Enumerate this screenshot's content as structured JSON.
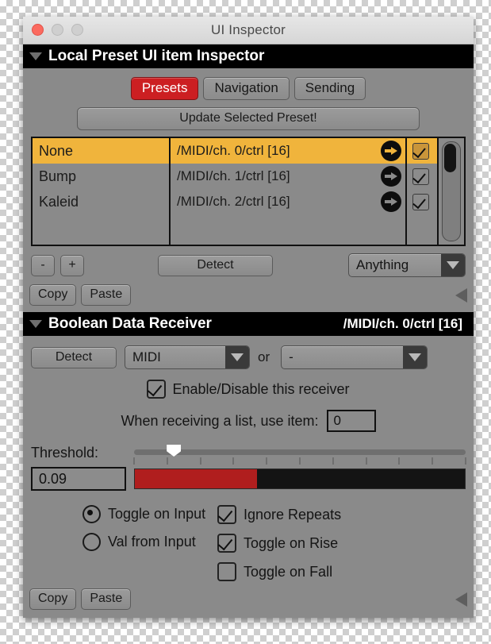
{
  "window": {
    "title": "UI Inspector",
    "traffic_lights": [
      "close-button",
      "minimize-button",
      "maximize-button"
    ]
  },
  "inspector_section": {
    "header_title": "Local Preset UI item Inspector",
    "tabs": [
      {
        "label": "Presets",
        "active": true
      },
      {
        "label": "Navigation",
        "active": false
      },
      {
        "label": "Sending",
        "active": false
      }
    ],
    "update_button": "Update Selected Preset!",
    "list": {
      "rows": [
        {
          "name": "None",
          "path": "/MIDI/ch. 0/ctrl [16]",
          "checked": true,
          "selected": true
        },
        {
          "name": "Bump",
          "path": "/MIDI/ch. 1/ctrl [16]",
          "checked": true,
          "selected": false
        },
        {
          "name": "Kaleid",
          "path": "/MIDI/ch. 2/ctrl [16]",
          "checked": true,
          "selected": false
        }
      ]
    },
    "controls": {
      "minus": "-",
      "plus": "+",
      "detect": "Detect",
      "filter_value": "Anything"
    },
    "copy": "Copy",
    "paste": "Paste"
  },
  "receiver_section": {
    "header_title": "Boolean Data Receiver",
    "header_path": "/MIDI/ch. 0/ctrl [16]",
    "detect": "Detect",
    "source_value": "MIDI",
    "or_text": "or",
    "alt_source_value": "-",
    "enable_label": "Enable/Disable this receiver",
    "enable_checked": true,
    "list_item_label": "When receiving a list, use item:",
    "list_item_value": "0",
    "threshold_label": "Threshold:",
    "threshold_value": "0.09",
    "threshold_percent": 12,
    "meter_percent": 37,
    "tick_count": 11,
    "options_left": [
      {
        "label": "Toggle on Input",
        "selected": true
      },
      {
        "label": "Val from Input",
        "selected": false
      }
    ],
    "options_right": [
      {
        "label": "Ignore Repeats",
        "checked": true
      },
      {
        "label": "Toggle on Rise",
        "checked": true
      },
      {
        "label": "Toggle on Fall",
        "checked": false
      }
    ],
    "copy": "Copy",
    "paste": "Paste"
  },
  "colors": {
    "accent_red": "#cc1f22",
    "selection_orange": "#f0b43c",
    "meter_red": "#b01e1e",
    "panel_gray": "#8a8a8a",
    "header_black": "#000000"
  }
}
